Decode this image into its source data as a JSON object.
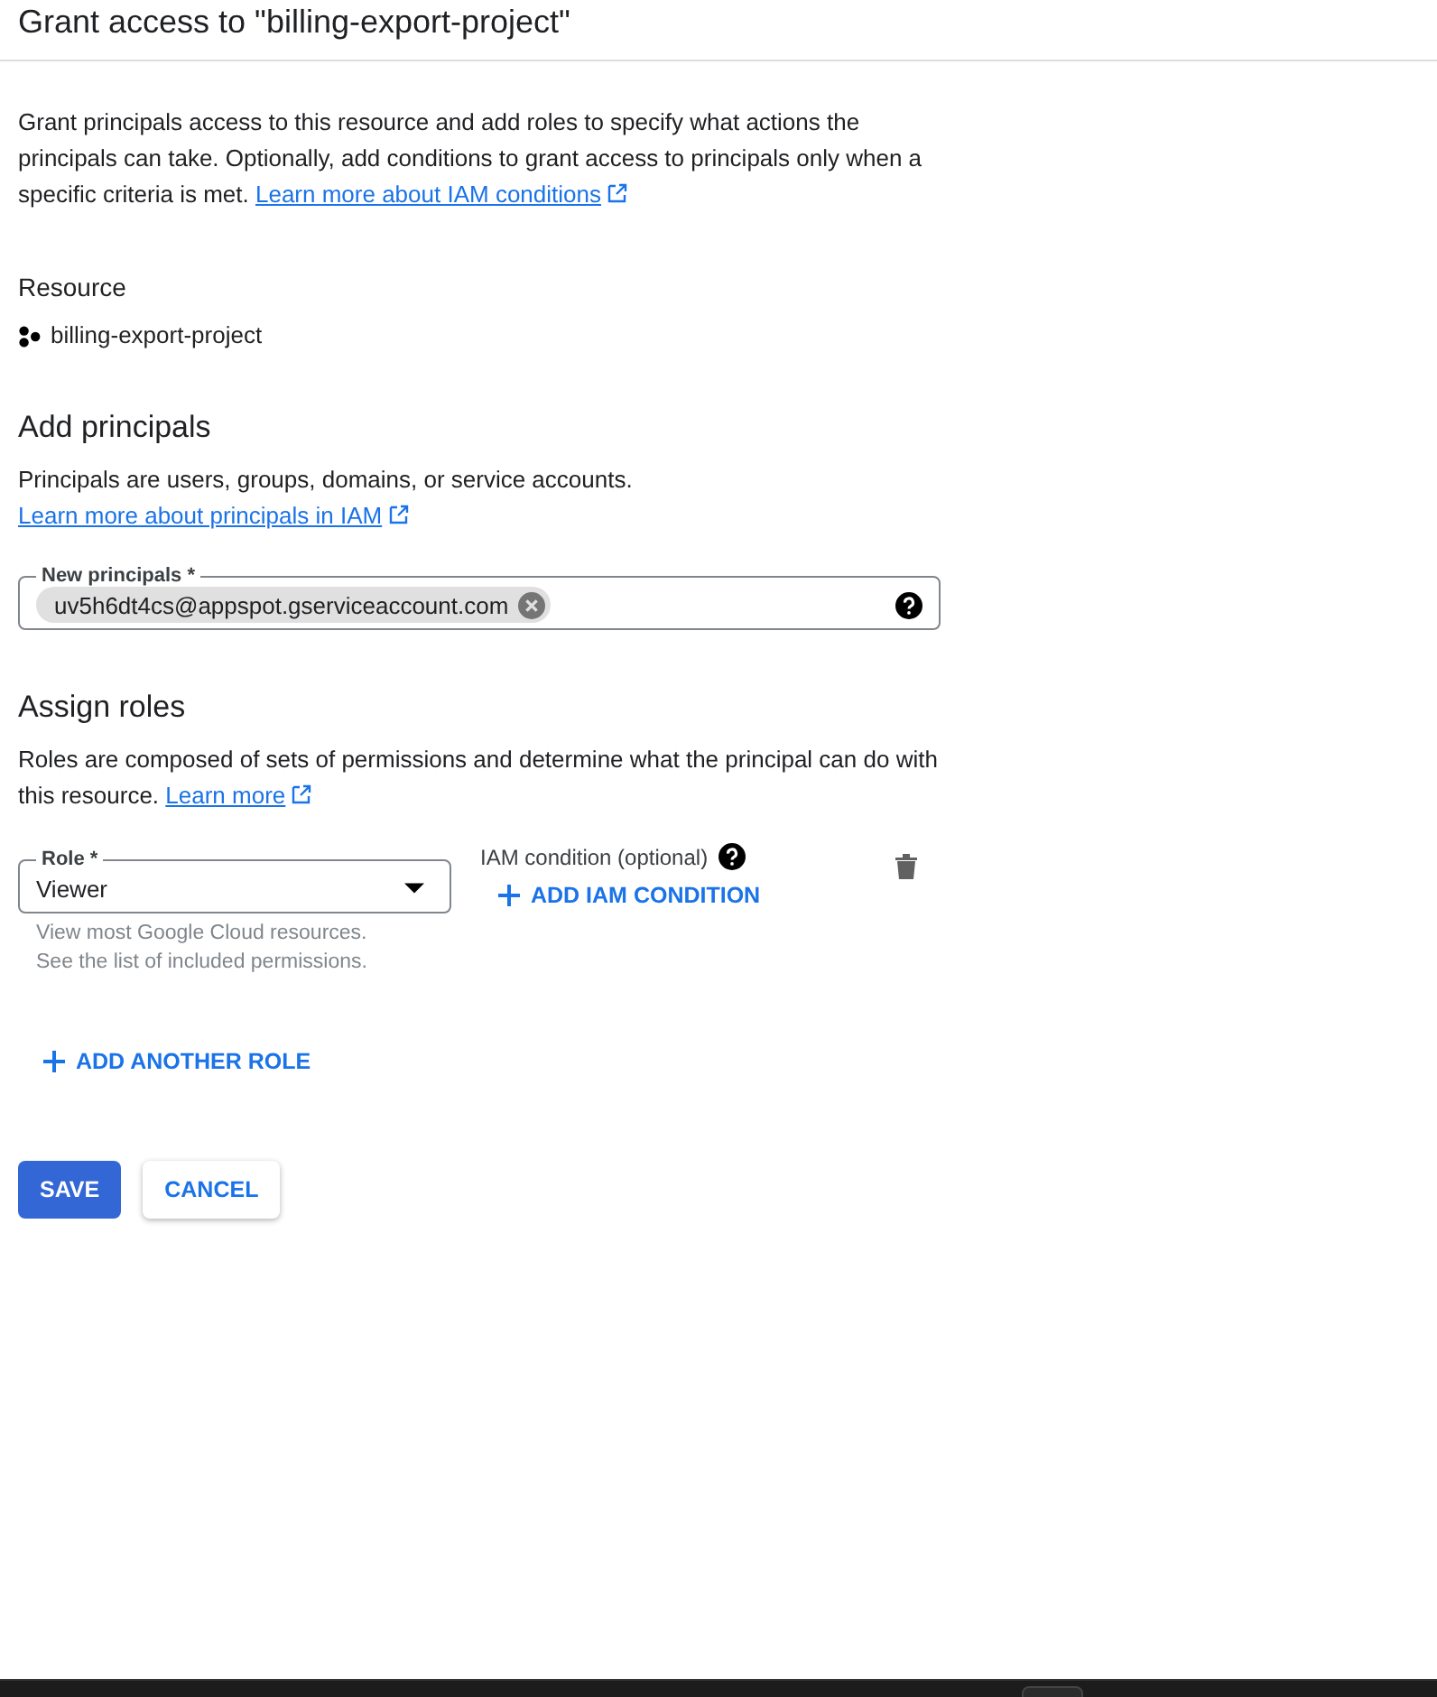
{
  "title": "Grant access to \"billing-export-project\"",
  "intro": {
    "text": "Grant principals access to this resource and add roles to specify what actions the principals can take. Optionally, add conditions to grant access to principals only when a specific criteria is met.",
    "link": "Learn more about IAM conditions"
  },
  "resource": {
    "heading": "Resource",
    "name": "billing-export-project"
  },
  "principals": {
    "heading": "Add principals",
    "text": "Principals are users, groups, domains, or service accounts.",
    "link": "Learn more about principals in IAM",
    "field": {
      "label": "New principals *",
      "chips": [
        {
          "text": "uv5h6dt4cs@appspot.gserviceaccount.com"
        }
      ]
    }
  },
  "roles": {
    "heading": "Assign roles",
    "text": "Roles are composed of sets of permissions and determine what the principal can do with this resource.",
    "link": "Learn more",
    "role_field": {
      "label": "Role *",
      "value": "Viewer"
    },
    "hints": [
      "View most Google Cloud resources.",
      "See the list of included permissions."
    ],
    "condition": {
      "label": "IAM condition (optional)",
      "button": "ADD IAM CONDITION"
    }
  },
  "add_role_button": "ADD ANOTHER ROLE",
  "buttons": [
    {
      "label": "SAVE",
      "kind": "primary"
    },
    {
      "label": "CANCEL",
      "kind": "secondary"
    }
  ]
}
